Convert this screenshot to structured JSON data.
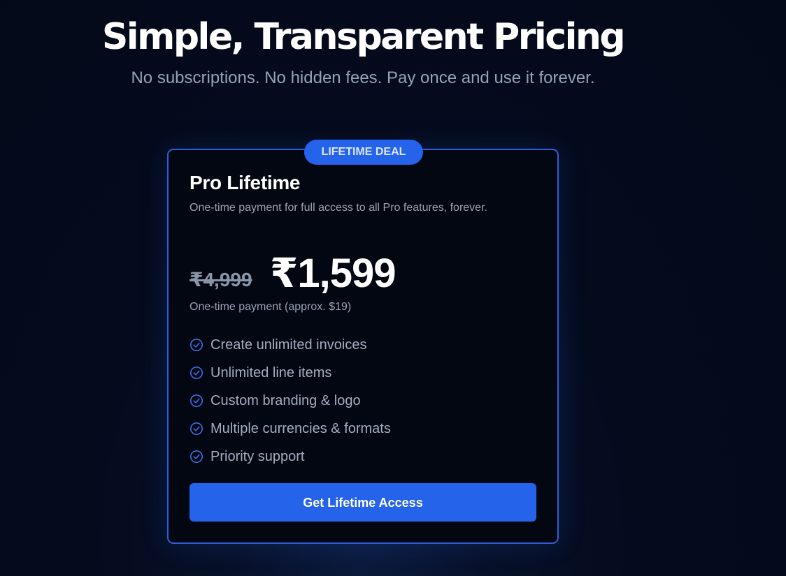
{
  "hero": {
    "title": "Simple, Transparent Pricing",
    "subtitle": "No subscriptions. No hidden fees. Pay once and use it forever."
  },
  "plan": {
    "badge": "LIFETIME DEAL",
    "name": "Pro Lifetime",
    "description": "One-time payment for full access to all Pro features, forever.",
    "old_price": "₹4,999",
    "price": "₹1,599",
    "price_note": "One-time payment (approx. $19)",
    "features": [
      "Create unlimited invoices",
      "Unlimited line items",
      "Custom branding & logo",
      "Multiple currencies & formats",
      "Priority support"
    ],
    "cta_label": "Get Lifetime Access"
  },
  "icons": {
    "feature_icon": "circle-check-icon"
  },
  "colors": {
    "background": "#050b1d",
    "accent": "#2563eb",
    "card_border": "#2f5ed8",
    "muted_text": "#94a3b8"
  }
}
